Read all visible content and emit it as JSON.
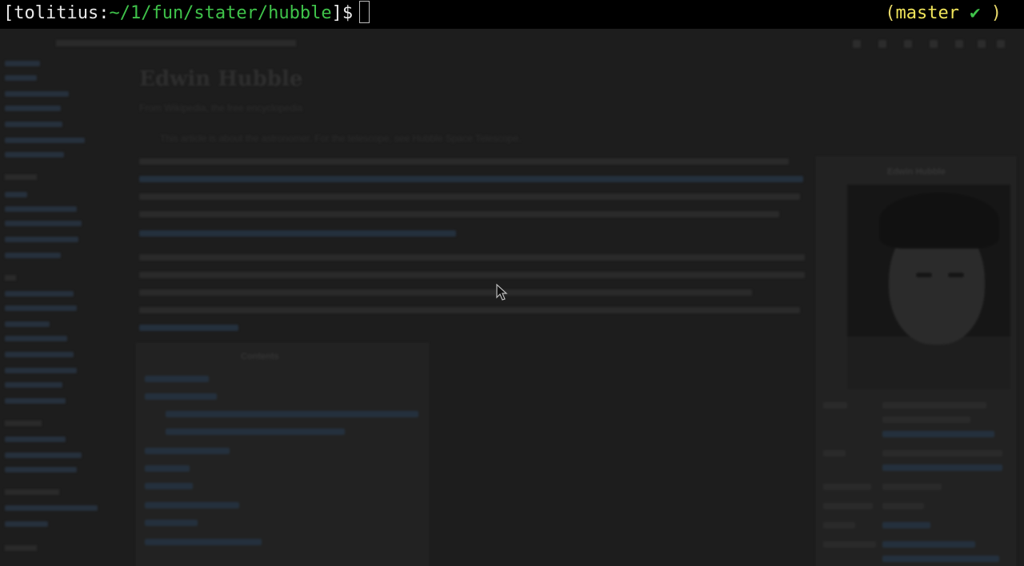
{
  "terminal": {
    "bracket_open": "[",
    "user": "tolitius",
    "colon": ":",
    "path": "~/1/fun/stater/hubble",
    "bracket_close": "]$",
    "git_open": "(",
    "branch": "master",
    "check": "✔",
    "git_close": ")"
  },
  "article": {
    "title": "Edwin Hubble",
    "subtitle": "From Wikipedia, the free encyclopedia",
    "hatnote": "This article is about the astronomer. For the telescope, see Hubble Space Telescope.",
    "toc_title": "Contents",
    "infobox_name": "Edwin Hubble"
  },
  "colors": {
    "terminal_bg": "#000000",
    "path": "#3fc34a",
    "branch": "#f0e45a",
    "page_dim": "#1d1d1d"
  }
}
